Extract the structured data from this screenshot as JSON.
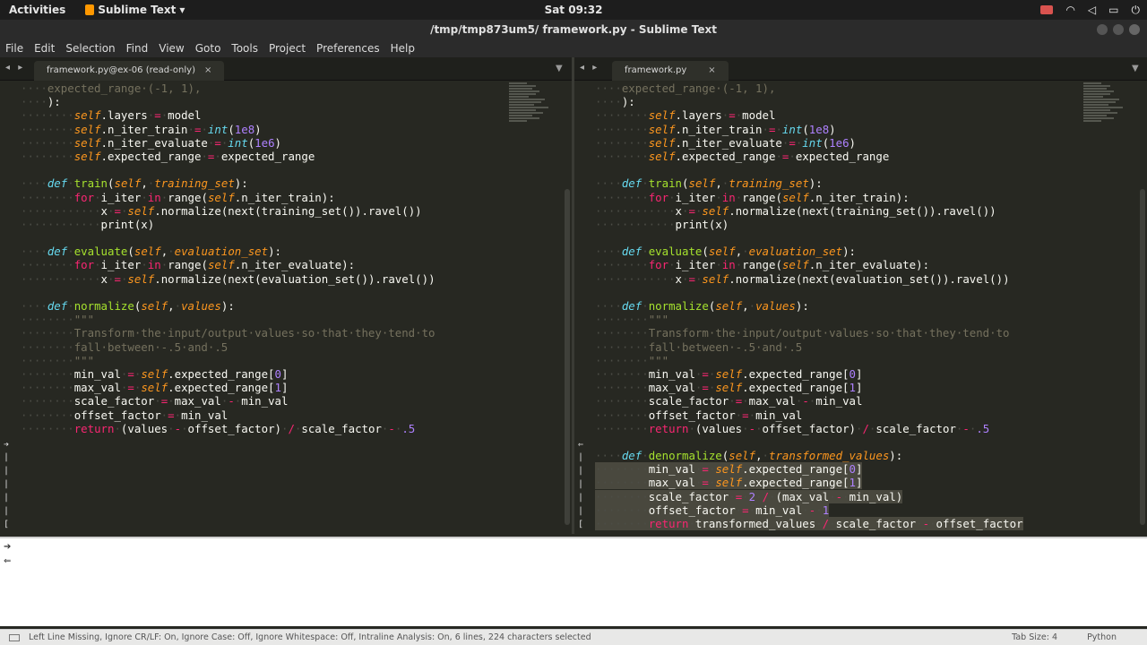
{
  "topbar": {
    "activities": "Activities",
    "app_name": "Sublime Text",
    "app_arrow": "▾",
    "clock": "Sat 09:32",
    "tray_icons": [
      "camera-icon",
      "wifi-icon",
      "volume-icon",
      "battery-icon",
      "power-icon"
    ]
  },
  "window": {
    "title": "/tmp/tmp873um5/ framework.py - Sublime Text"
  },
  "menu": [
    "File",
    "Edit",
    "Selection",
    "Find",
    "View",
    "Goto",
    "Tools",
    "Project",
    "Preferences",
    "Help"
  ],
  "tabs": {
    "left": {
      "label": "framework.py@ex-06 (read-only)",
      "close": "×"
    },
    "right": {
      "label": "framework.py",
      "close": "×"
    },
    "nav": "◂ ▸",
    "dropdown": "▼"
  },
  "status": {
    "text": "Left Line Missing, Ignore CR/LF: On, Ignore Case: Off, Ignore Whitespace: Off, Intraline Analysis: On, 6 lines, 224 characters selected",
    "tab_size": "Tab Size: 4",
    "syntax": "Python"
  },
  "colors": {
    "background": "#272822",
    "keyword": "#f92672",
    "self": "#fd971f",
    "function": "#a6e22e",
    "number": "#ae81ff",
    "comment": "#75715e",
    "builtin": "#66d9ef"
  }
}
